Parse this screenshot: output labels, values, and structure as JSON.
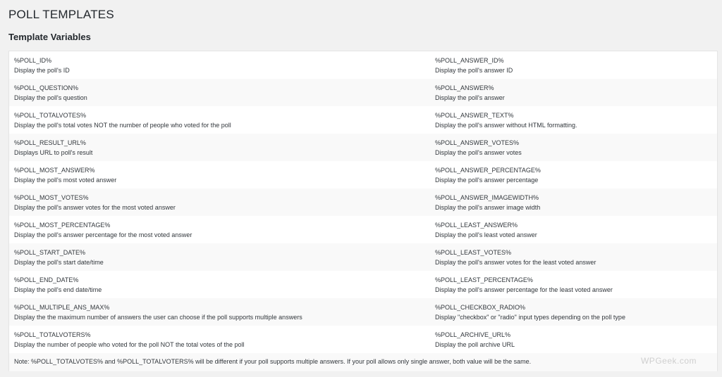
{
  "page": {
    "title": "POLL TEMPLATES",
    "section_title": "Template Variables"
  },
  "rows": [
    {
      "left": {
        "name": "%POLL_ID%",
        "desc": "Display the poll's ID"
      },
      "right": {
        "name": "%POLL_ANSWER_ID%",
        "desc": "Display the poll's answer ID"
      }
    },
    {
      "left": {
        "name": "%POLL_QUESTION%",
        "desc": "Display the poll's question"
      },
      "right": {
        "name": "%POLL_ANSWER%",
        "desc": "Display the poll's answer"
      }
    },
    {
      "left": {
        "name": "%POLL_TOTALVOTES%",
        "desc": "Display the poll's total votes NOT the number of people who voted for the poll"
      },
      "right": {
        "name": "%POLL_ANSWER_TEXT%",
        "desc": "Display the poll's answer without HTML formatting."
      }
    },
    {
      "left": {
        "name": "%POLL_RESULT_URL%",
        "desc": "Displays URL to poll's result"
      },
      "right": {
        "name": "%POLL_ANSWER_VOTES%",
        "desc": "Display the poll's answer votes"
      }
    },
    {
      "left": {
        "name": "%POLL_MOST_ANSWER%",
        "desc": "Display the poll's most voted answer"
      },
      "right": {
        "name": "%POLL_ANSWER_PERCENTAGE%",
        "desc": "Display the poll's answer percentage"
      }
    },
    {
      "left": {
        "name": "%POLL_MOST_VOTES%",
        "desc": "Display the poll's answer votes for the most voted answer"
      },
      "right": {
        "name": "%POLL_ANSWER_IMAGEWIDTH%",
        "desc": "Display the poll's answer image width"
      }
    },
    {
      "left": {
        "name": "%POLL_MOST_PERCENTAGE%",
        "desc": "Display the poll's answer percentage for the most voted answer"
      },
      "right": {
        "name": "%POLL_LEAST_ANSWER%",
        "desc": "Display the poll's least voted answer"
      }
    },
    {
      "left": {
        "name": "%POLL_START_DATE%",
        "desc": "Display the poll's start date/time"
      },
      "right": {
        "name": "%POLL_LEAST_VOTES%",
        "desc": "Display the poll's answer votes for the least voted answer"
      }
    },
    {
      "left": {
        "name": "%POLL_END_DATE%",
        "desc": "Display the poll's end date/time"
      },
      "right": {
        "name": "%POLL_LEAST_PERCENTAGE%",
        "desc": "Display the poll's answer percentage for the least voted answer"
      }
    },
    {
      "left": {
        "name": "%POLL_MULTIPLE_ANS_MAX%",
        "desc": "Display the the maximum number of answers the user can choose if the poll supports multiple answers"
      },
      "right": {
        "name": "%POLL_CHECKBOX_RADIO%",
        "desc": "Display \"checkbox\" or \"radio\" input types depending on the poll type"
      }
    },
    {
      "left": {
        "name": "%POLL_TOTALVOTERS%",
        "desc": "Display the number of people who voted for the poll NOT the total votes of the poll"
      },
      "right": {
        "name": "%POLL_ARCHIVE_URL%",
        "desc": "Display the poll archive URL"
      }
    }
  ],
  "note": "Note: %POLL_TOTALVOTES% and %POLL_TOTALVOTERS% will be different if your poll supports multiple answers. If your poll allows only single answer, both value will be the same.",
  "watermark": "WPGeek.com"
}
